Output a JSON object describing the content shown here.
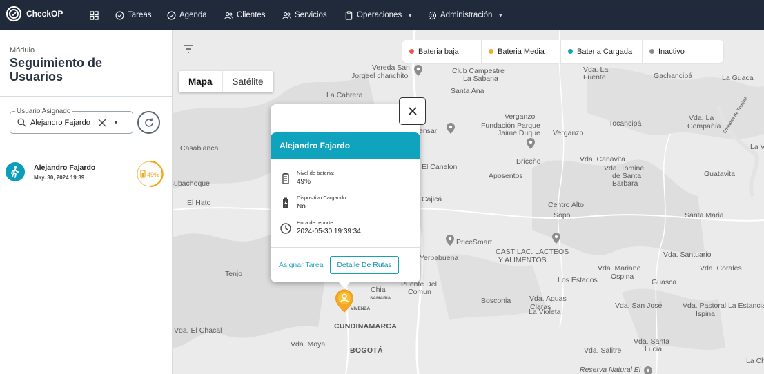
{
  "nav": {
    "brand": "CheckOP",
    "items": [
      {
        "label": "Tareas",
        "icon": "check-circle-icon"
      },
      {
        "label": "Agenda",
        "icon": "check-circle-icon"
      },
      {
        "label": "Clientes",
        "icon": "users-icon"
      },
      {
        "label": "Servicios",
        "icon": "users-icon"
      },
      {
        "label": "Operaciones",
        "icon": "clipboard-icon"
      },
      {
        "label": "Administración",
        "icon": "gear-icon"
      }
    ]
  },
  "sidebar": {
    "module_label": "Módulo",
    "title": "Seguimiento de Usuarios",
    "filter": {
      "legend": "Usuario Asignado",
      "value": "Alejandro Fajardo"
    },
    "users": [
      {
        "name": "Alejandro Fajardo",
        "timestamp": "May. 30, 2024 19:39",
        "battery": "49%"
      }
    ]
  },
  "legend": [
    {
      "label": "Bateria baja",
      "color": "#ef5350"
    },
    {
      "label": "Bateria Media",
      "color": "#f5a623"
    },
    {
      "label": "Bateria Cargada",
      "color": "#0fa3bd"
    },
    {
      "label": "Inactivo",
      "color": "#8a8a8a"
    }
  ],
  "map_type": {
    "map": "Mapa",
    "satellite": "Satélite"
  },
  "popup": {
    "title": "Alejandro Fajardo",
    "battery_label": "Nivel de bateria:",
    "battery_value": "49%",
    "charging_label": "Dispositivo Cargando:",
    "charging_value": "No",
    "report_label": "Hora de reporte:",
    "report_value": "2024-05-30 19:39:34",
    "assign_link": "Asignar Tarea",
    "route_button": "Detalle De Rutas"
  },
  "map_labels": [
    "Vereda San",
    "Jorgeel chanchito",
    "Club Campestre",
    "La Sabana",
    "Vda. La",
    "Fuente",
    "Gachancipá",
    "La Guaca",
    "La Cabrera",
    "Santa Ana",
    "Verganzo",
    "Fundación Parque",
    "Jaime Duque",
    "Verganzo",
    "Tocancipá",
    "Vda. La",
    "Compañía",
    "Casablanca",
    "El Canelon",
    "Briceño",
    "Vda. Canavita",
    "Vda. Tomine",
    "de Santa",
    "Barbara",
    "Guatavita",
    "Subachoque",
    "Aposentos",
    "El Hato",
    "Cajicá",
    "Centro Alto",
    "Sopo",
    "Santa Maria",
    "PriceSmart",
    "CASTILAC. LACTEOS",
    "Y ALIMENTOS",
    "Yerbabuena",
    "Vda. Santuario",
    "Tenjo",
    "Vda. Mariano",
    "Ospina",
    "Vda. Corales",
    "Los Estados",
    "Guasca",
    "Chia",
    "SAMARIA",
    "Puente Del",
    "Comun",
    "Bosconia",
    "Vda. Aguas",
    "Claras",
    "La Violeta",
    "Vda. San José",
    "Vda. Pastoral La Estancia",
    "Ispina",
    "VIVENZA",
    "CUNDINAMARCA",
    "Vda. El Chacal",
    "Vda. Moya",
    "BOGOTÁ",
    "Vda. Santa",
    "Lucia",
    "Vda. Salitre",
    "Reserva Natural El",
    "La Ch",
    "La V",
    "Embalse de Tominé",
    "ensar"
  ]
}
